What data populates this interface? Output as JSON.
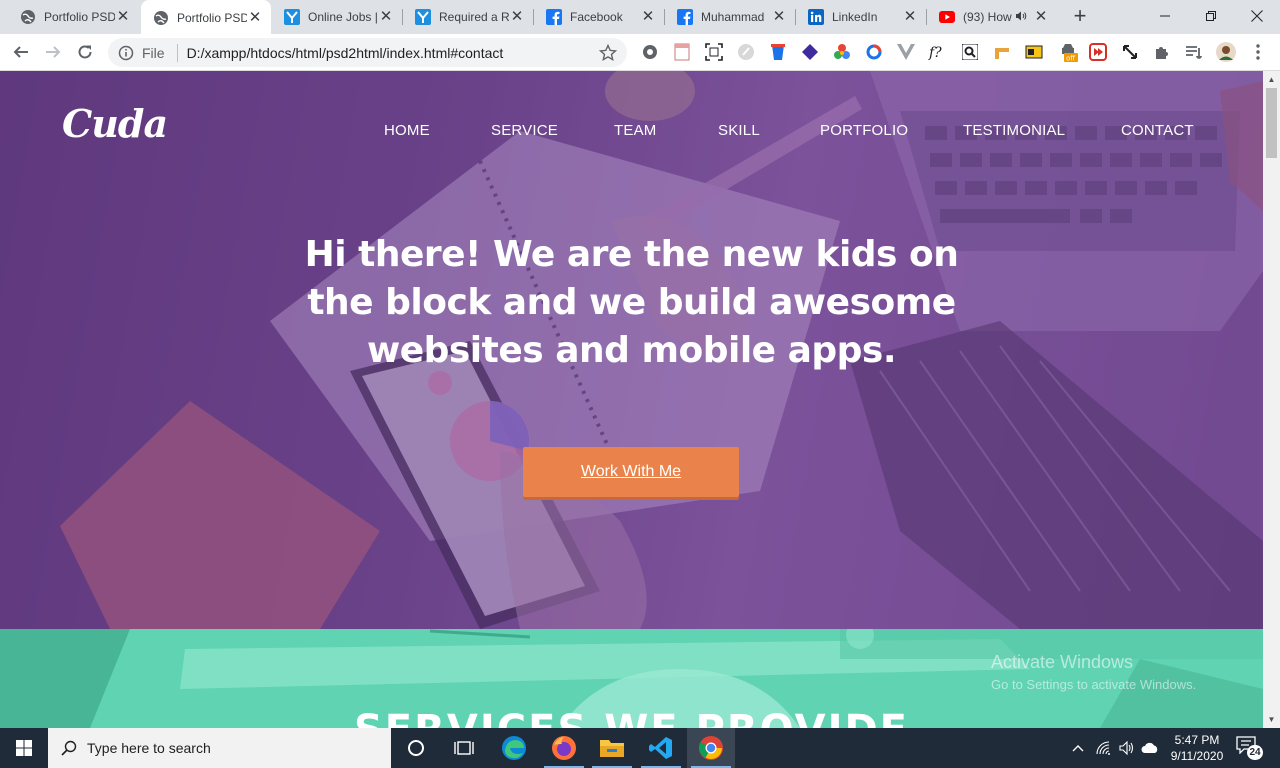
{
  "browser": {
    "tabs": [
      {
        "title": "Portfolio PSD",
        "icon": "globe-icon",
        "active": false,
        "muted_audio": false
      },
      {
        "title": "Portfolio PSD",
        "icon": "globe-icon",
        "active": true,
        "muted_audio": false
      },
      {
        "title": "Online Jobs |",
        "icon": "upwork-y-icon",
        "active": false,
        "muted_audio": false
      },
      {
        "title": "Required a R",
        "icon": "upwork-y-icon",
        "active": false,
        "muted_audio": false
      },
      {
        "title": "Facebook",
        "icon": "facebook-icon",
        "active": false,
        "muted_audio": false
      },
      {
        "title": "Muhammad",
        "icon": "facebook-icon",
        "active": false,
        "muted_audio": false
      },
      {
        "title": "LinkedIn",
        "icon": "linkedin-icon",
        "active": false,
        "muted_audio": false
      },
      {
        "title": "(93) How",
        "icon": "youtube-icon",
        "active": false,
        "muted_audio": true
      }
    ],
    "close_glyph": "✕",
    "new_tab_glyph": "+",
    "address": {
      "scheme_label": "File",
      "url": "D:/xampp/htdocs/html/psd2html/index.html#contact"
    },
    "window_controls": {
      "minimize": "—",
      "restore": "❐",
      "close": "✕"
    }
  },
  "site": {
    "logo": "Cuda",
    "nav": [
      "HOME",
      "SERVICE",
      "TEAM",
      "SKILL",
      "PORTFOLIO",
      "TESTIMONIAL",
      "CONTACT"
    ],
    "hero": {
      "headline_lines": [
        "Hi there! We are the new kids on",
        "the block and we build awesome",
        "websites and mobile apps."
      ],
      "cta": "Work With Me"
    },
    "services_title": "SERVICES WE PROVIDE",
    "colors": {
      "hero_overlay": "#6a4591",
      "cta": "#e9834b",
      "services_bg": "#5fd3b2"
    }
  },
  "watermark": {
    "line1": "Activate Windows",
    "line2": "Go to Settings to activate Windows."
  },
  "taskbar": {
    "search_placeholder": "Type here to search",
    "apps": [
      "cortana-icon",
      "task-view-icon",
      "edge-icon",
      "firefox-icon",
      "file-explorer-icon",
      "vscode-icon",
      "chrome-icon"
    ],
    "time": "5:47 PM",
    "date": "9/11/2020",
    "notification_count": "24"
  }
}
